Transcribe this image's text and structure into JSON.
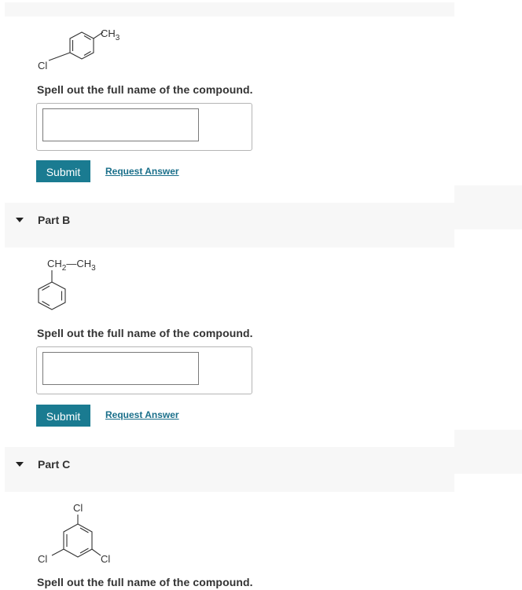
{
  "part_a": {
    "molecule": {
      "ch3": "CH",
      "ch3_sub": "3",
      "cl": "Cl"
    },
    "prompt": "Spell out the full name of the compound.",
    "answer_value": "",
    "submit_label": "Submit",
    "request_label": "Request Answer"
  },
  "part_b": {
    "title": "Part B",
    "molecule": {
      "ch2": "CH",
      "ch2_sub": "2",
      "dash": "—",
      "ch3": "CH",
      "ch3_sub": "3"
    },
    "prompt": "Spell out the full name of the compound.",
    "answer_value": "",
    "submit_label": "Submit",
    "request_label": "Request Answer"
  },
  "part_c": {
    "title": "Part C",
    "molecule": {
      "cl_top": "Cl",
      "cl_left": "Cl",
      "cl_right": "Cl"
    },
    "prompt": "Spell out the full name of the compound."
  },
  "icons": {
    "part_toggle": "caret-down-icon"
  },
  "colors": {
    "header_bg": "#f7f7f7",
    "submit_bg": "#1a7b91",
    "link": "#1a6f8a",
    "text": "#333333"
  }
}
